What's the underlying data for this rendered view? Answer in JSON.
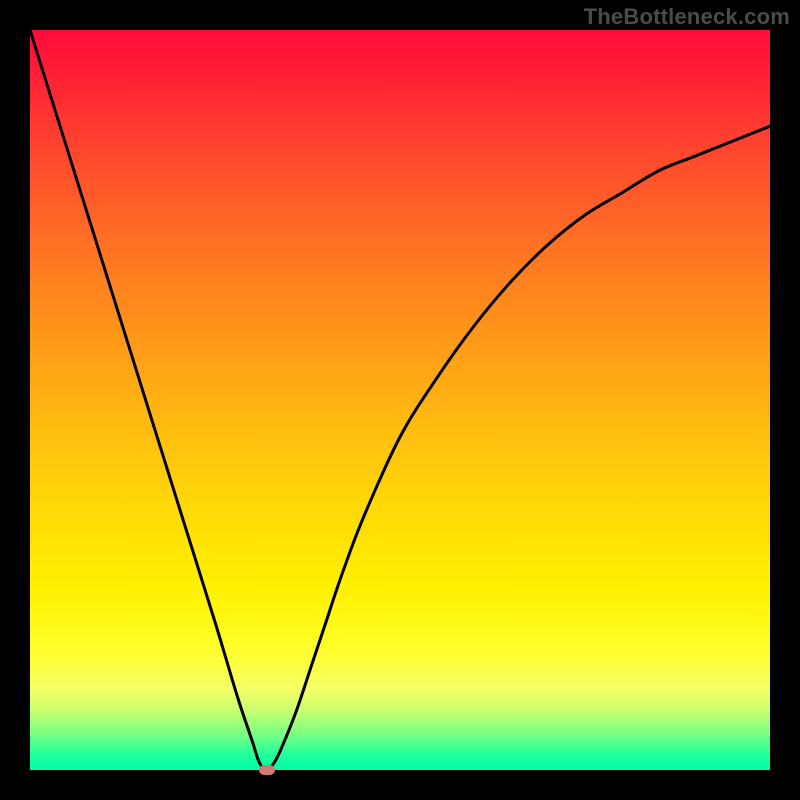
{
  "watermark": "TheBottleneck.com",
  "colors": {
    "frame": "#000000",
    "curve": "#000000",
    "dot": "#cf7a76",
    "gradient_top": "#ff0b3b",
    "gradient_mid": "#ffd808",
    "gradient_bottom": "#00fda4"
  },
  "chart_data": {
    "type": "line",
    "title": "",
    "xlabel": "",
    "ylabel": "",
    "xlim": [
      0,
      100
    ],
    "ylim": [
      0,
      100
    ],
    "grid": false,
    "legend": false,
    "series": [
      {
        "name": "bottleneck-curve",
        "x": [
          0,
          5,
          10,
          15,
          20,
          25,
          28,
          30,
          31,
          32,
          33,
          34,
          36,
          38,
          40,
          42,
          45,
          50,
          55,
          60,
          65,
          70,
          75,
          80,
          85,
          90,
          95,
          100
        ],
        "y": [
          100,
          84,
          68,
          52,
          36,
          20,
          10,
          4,
          1,
          0,
          1,
          3,
          8,
          14,
          20,
          26,
          34,
          45,
          53,
          60,
          66,
          71,
          75,
          78,
          81,
          83,
          85,
          87
        ]
      }
    ],
    "annotations": [
      {
        "name": "minimum-dot",
        "x": 32,
        "y": 0
      }
    ]
  }
}
